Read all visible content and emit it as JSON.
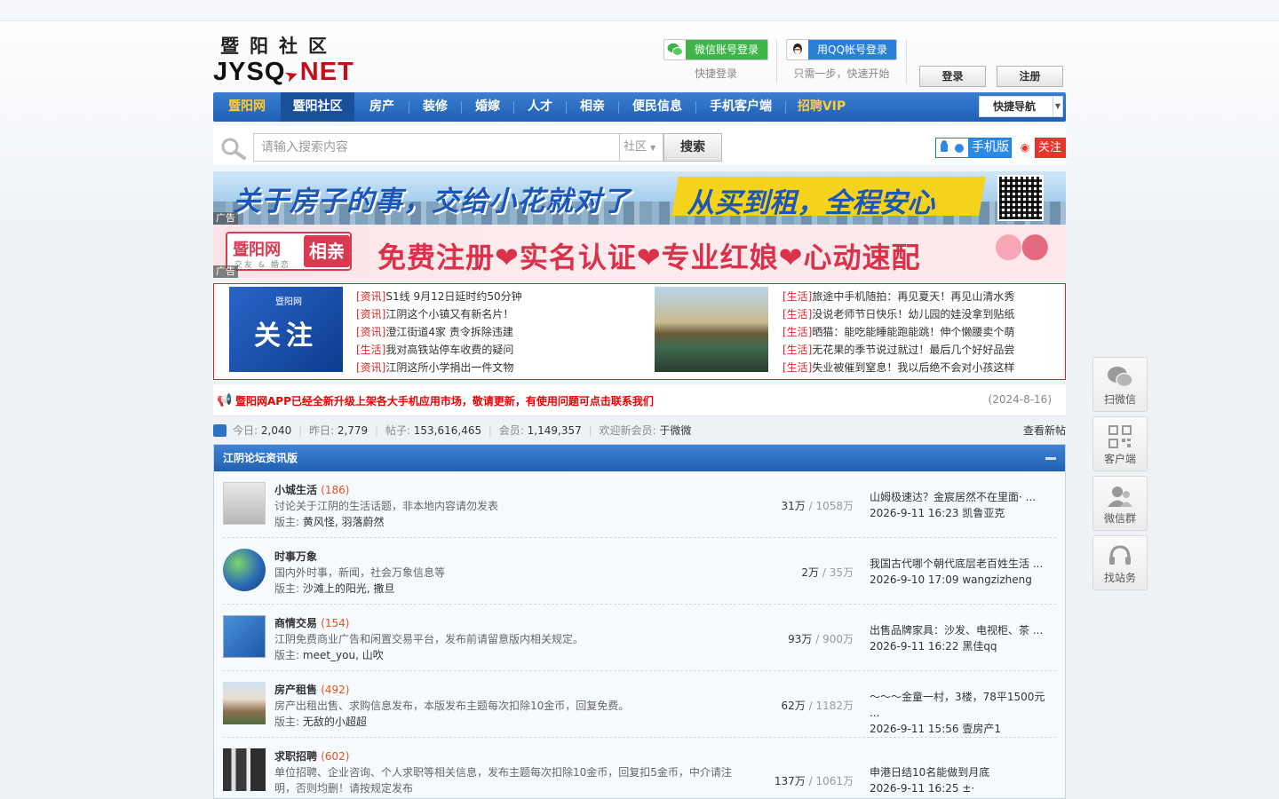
{
  "logo": {
    "cn": "暨阳社区",
    "en_a": "JYSQ",
    "en_b": "NET"
  },
  "login": {
    "wechat_btn": "微信账号登录",
    "wechat_sub": "快捷登录",
    "qq_btn": "用QQ帐号登录",
    "qq_sub": "只需一步，快速开始",
    "login": "登录",
    "register": "注册"
  },
  "nav": {
    "items": [
      "暨阳网",
      "暨阳社区",
      "房产",
      "装修",
      "婚嫁",
      "人才",
      "相亲",
      "便民信息",
      "手机客户端",
      "招聘VIP"
    ],
    "quick": "快捷导航"
  },
  "search": {
    "placeholder": "请输入搜索内容",
    "scope": "社区",
    "button": "搜索",
    "mobile": "手机版",
    "follow": "关注"
  },
  "ads": {
    "tag": "广告",
    "ad1_left": "关于房子的事，交给小花就对了",
    "ad1_right": "从买到租，全程安心",
    "ad2_brand": "暨阳网",
    "ad2_brand_box": "相亲",
    "ad2_brand_sub": "交友 & 婚恋",
    "ad2_slogan": "免费注册❤实名认证❤专业红娘❤心动速配"
  },
  "hot": {
    "pic1_title": "关注",
    "pic1_brand": "暨阳网",
    "left": [
      {
        "tag": "[资讯]",
        "title": "S1线 9月12日延时约50分钟"
      },
      {
        "tag": "[资讯]",
        "title": "江阴这个小镇又有新名片！"
      },
      {
        "tag": "[资讯]",
        "title": "澄江街道4家 责令拆除违建"
      },
      {
        "tag": "[生活]",
        "title": "我对高铁站停车收费的疑问"
      },
      {
        "tag": "[资讯]",
        "title": "江阴这所小学捐出一件文物"
      }
    ],
    "right": [
      {
        "tag": "[生活]",
        "title": "旅途中手机随拍：再见夏天！再见山清水秀"
      },
      {
        "tag": "[生活]",
        "title": "没说老师节日快乐！幼儿园的娃没拿到贴纸"
      },
      {
        "tag": "[生活]",
        "title": "晒猫：能吃能睡能跑能跳！伸个懒腰卖个萌"
      },
      {
        "tag": "[生活]",
        "title": "无花果的季节说过就过！最后几个好好品尝"
      },
      {
        "tag": "[生活]",
        "title": "失业被催到窒息！我以后绝不会对小孩这样"
      }
    ]
  },
  "notice": {
    "text": "暨阳网APP已经全新升级上架各大手机应用市场，敬请更新，有使用问题可点击联系我们",
    "date": "(2024-8-16)"
  },
  "stats": {
    "today_label": "今日:",
    "today": "2,040",
    "yesterday_label": "昨日:",
    "yesterday": "2,779",
    "posts_label": "帖子:",
    "posts": "153,616,465",
    "members_label": "会员:",
    "members": "1,149,357",
    "welcome_label": "欢迎新会员:",
    "welcome_user": "于微微",
    "view_new": "查看新帖"
  },
  "forum": {
    "title": "江阴论坛资讯版",
    "boards": [
      {
        "name": "小城生活",
        "count": "(186)",
        "desc": "讨论关于江阴的生活话题，非本地内容请勿发表",
        "mods_label": "版主:",
        "mods": "黄风怪, 羽落蔚然",
        "threads": "31万",
        "posts": "/ 1058万",
        "last_title": "山姆极速达？金宸居然不在里面· ...",
        "last_info": "2026-9-11 16:23 凯鲁亚克"
      },
      {
        "name": "时事万象",
        "count": "",
        "desc": "国内外时事，新闻，社会万象信息等",
        "mods_label": "版主:",
        "mods": "沙滩上的阳光, 撒旦",
        "threads": "2万",
        "posts": "/ 35万",
        "last_title": "我国古代哪个朝代底层老百姓生活 ...",
        "last_info": "2026-9-10 17:09 wangzizheng"
      },
      {
        "name": "商情交易",
        "count": "(154)",
        "desc": "江阴免费商业广告和闲置交易平台，发布前请留意版内相关规定。",
        "mods_label": "版主:",
        "mods": "meet_you, 山吹",
        "threads": "93万",
        "posts": "/ 900万",
        "last_title": "出售品牌家具：沙发、电视柜、茶 ...",
        "last_info": "2026-9-11 16:22 黑佳qq"
      },
      {
        "name": "房产租售",
        "count": "(492)",
        "desc": "房产出租出售、求购信息发布，本版发布主题每次扣除10金币，回复免费。",
        "mods_label": "版主:",
        "mods": "无敌的小超超",
        "threads": "62万",
        "posts": "/ 1182万",
        "last_title": "～～～金童一村，3楼，78平1500元 ...",
        "last_info": "2026-9-11 15:56 壹房产1"
      },
      {
        "name": "求职招聘",
        "count": "(602)",
        "desc": "单位招聘、企业咨询、个人求职等相关信息，发布主题每次扣除10金币，回复扣5金币，中介请注明，否则均删！请按规定发布",
        "mods_label": "",
        "mods": "",
        "threads": "137万",
        "posts": "/ 1061万",
        "last_title": "申港日结10名能做到月底",
        "last_info": "2026-9-11 16:25 ±·"
      }
    ]
  },
  "side": [
    "扫微信",
    "客户端",
    "微信群",
    "找站务"
  ],
  "colors": {
    "nav_blue": "#2a6cc2",
    "accent_red": "#d22a2a",
    "gold": "#ffcc33"
  }
}
